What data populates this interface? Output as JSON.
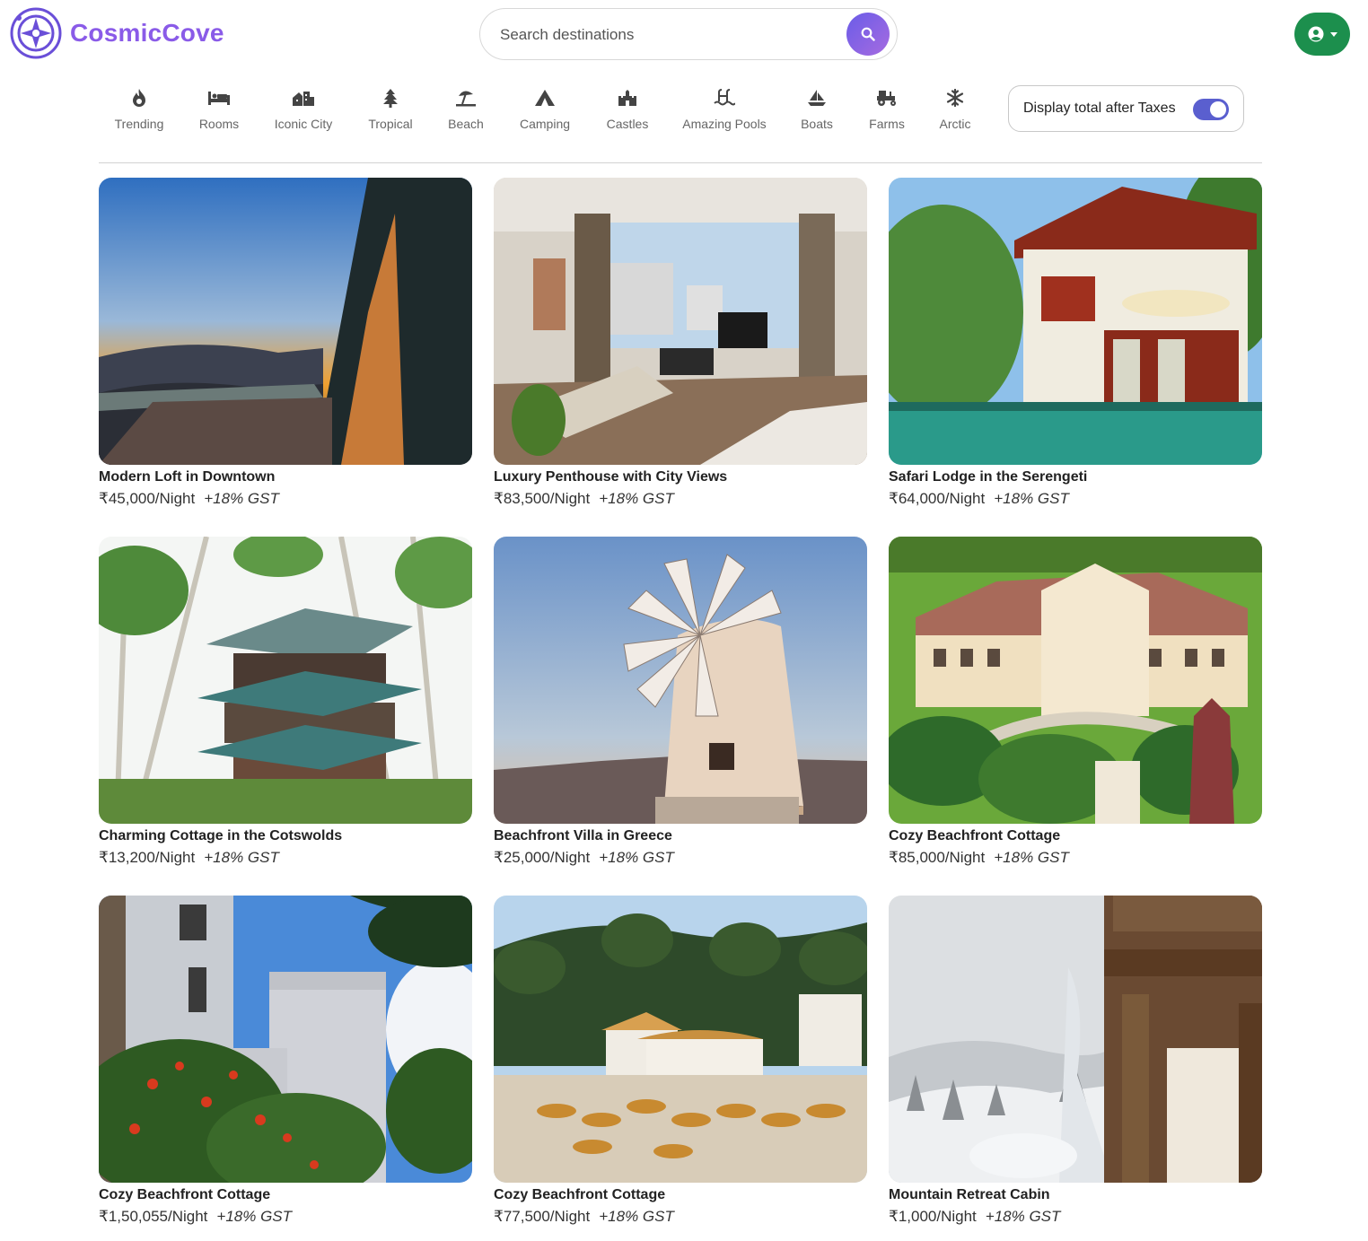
{
  "header": {
    "brand": "CosmicCove",
    "search_placeholder": "Search destinations"
  },
  "categories": [
    {
      "label": "Trending",
      "icon": "fire-icon"
    },
    {
      "label": "Rooms",
      "icon": "bed-icon"
    },
    {
      "label": "Iconic City",
      "icon": "city-icon"
    },
    {
      "label": "Tropical",
      "icon": "tree-icon"
    },
    {
      "label": "Beach",
      "icon": "umbrella-beach-icon"
    },
    {
      "label": "Camping",
      "icon": "tent-icon"
    },
    {
      "label": "Castles",
      "icon": "castle-icon"
    },
    {
      "label": "Amazing Pools",
      "icon": "pool-icon"
    },
    {
      "label": "Boats",
      "icon": "sailboat-icon"
    },
    {
      "label": "Farms",
      "icon": "tractor-icon"
    },
    {
      "label": "Arctic",
      "icon": "snowflake-icon"
    }
  ],
  "tax_toggle": {
    "label": "Display total after Taxes",
    "enabled": true
  },
  "colors": {
    "brand": "#8a5be8",
    "user_button": "#1c8f4d",
    "toggle_on": "#5a5fcf"
  },
  "listings": [
    {
      "title": "Modern Loft in Downtown",
      "price": "₹45,000/Night",
      "gst": "+18% GST"
    },
    {
      "title": "Luxury Penthouse with City Views",
      "price": "₹83,500/Night",
      "gst": "+18% GST"
    },
    {
      "title": "Safari Lodge in the Serengeti",
      "price": "₹64,000/Night",
      "gst": "+18% GST"
    },
    {
      "title": "Charming Cottage in the Cotswolds",
      "price": "₹13,200/Night",
      "gst": "+18% GST"
    },
    {
      "title": "Beachfront Villa in Greece",
      "price": "₹25,000/Night",
      "gst": "+18% GST"
    },
    {
      "title": "Cozy Beachfront Cottage",
      "price": "₹85,000/Night",
      "gst": "+18% GST"
    },
    {
      "title": "Cozy Beachfront Cottage",
      "price": "₹1,50,055/Night",
      "gst": "+18% GST"
    },
    {
      "title": "Cozy Beachfront Cottage",
      "price": "₹77,500/Night",
      "gst": "+18% GST"
    },
    {
      "title": "Mountain Retreat Cabin",
      "price": "₹1,000/Night",
      "gst": "+18% GST"
    }
  ]
}
